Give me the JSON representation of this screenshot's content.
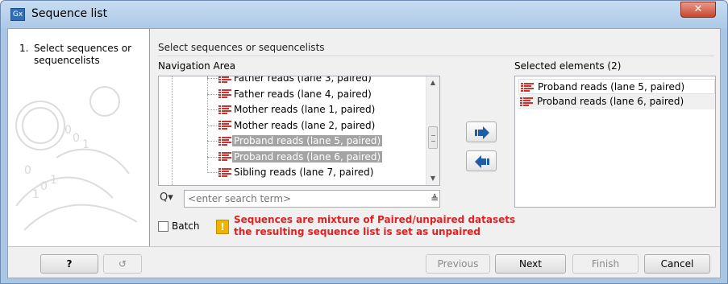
{
  "window": {
    "title": "Sequence list",
    "app_icon": "Gx",
    "close_glyph": "✕"
  },
  "steps": [
    {
      "number": "1.",
      "label": "Select sequences or sequencelists"
    }
  ],
  "main": {
    "header": "Select sequences or sequencelists",
    "navigation_label": "Navigation Area",
    "selected_label": "Selected elements (2)"
  },
  "tree": {
    "items": [
      {
        "label": "Father reads (lane 3, paired)",
        "selected": false
      },
      {
        "label": "Father reads (lane 4, paired)",
        "selected": false
      },
      {
        "label": "Mother reads (lane 1, paired)",
        "selected": false
      },
      {
        "label": "Mother reads (lane 2, paired)",
        "selected": false
      },
      {
        "label": "Proband reads (lane 5, paired)",
        "selected": true
      },
      {
        "label": "Proband reads (lane 6, paired)",
        "selected": true
      },
      {
        "label": "Sibling reads (lane 7, paired)",
        "selected": false
      }
    ]
  },
  "search": {
    "icon": "search-icon",
    "glyph": "Q▾",
    "placeholder": "<enter search term>",
    "menu_glyph": "≜"
  },
  "selected_elements": [
    "Proband reads (lane 5, paired)",
    "Proband reads (lane 6, paired)"
  ],
  "batch": {
    "label": "Batch",
    "checked": false
  },
  "warning": {
    "icon_glyph": "!",
    "line1": "Sequences are mixture of Paired/unpaired datasets",
    "line2": "the resulting sequence list is set as unpaired",
    "color": "#e41f1f"
  },
  "buttons": {
    "help": "?",
    "reset": "↺",
    "previous": "Previous",
    "next": "Next",
    "finish": "Finish",
    "cancel": "Cancel"
  },
  "colors": {
    "accent": "#2f6fb8",
    "selection": "#a4a4a4",
    "seq_icon": "#d0312d"
  }
}
